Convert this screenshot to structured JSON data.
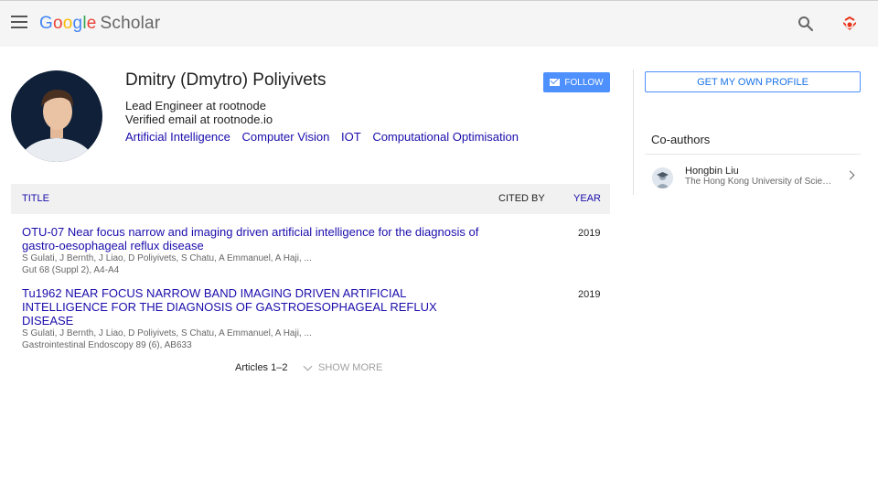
{
  "header": {
    "logo": {
      "g1": "G",
      "o1": "o",
      "o2": "o",
      "g2": "g",
      "l": "l",
      "e": "e",
      "scholar": "Scholar"
    },
    "icons": {
      "menu": "menu-icon",
      "search": "search-icon",
      "apps": "scholar-logo-icon"
    }
  },
  "profile": {
    "name": "Dmitry (Dmytro) Poliyivets",
    "affiliation": "Lead Engineer at rootnode",
    "verified": "Verified email at rootnode.io",
    "interests": [
      "Artificial Intelligence",
      "Computer Vision",
      "IOT",
      "Computational Optimisation"
    ],
    "follow_label": "FOLLOW"
  },
  "table": {
    "col_title": "TITLE",
    "col_cited": "CITED BY",
    "col_year": "YEAR",
    "articles": [
      {
        "title": "OTU-07 Near focus narrow and imaging driven artificial intelligence for the diagnosis of gastro-oesophageal reflux disease",
        "authors": "S Gulati, J Bernth, J Liao, D Poliyivets, S Chatu, A Emmanuel, A Haji, ...",
        "venue": "Gut 68 (Suppl 2), A4-A4",
        "year": "2019"
      },
      {
        "title": "Tu1962 NEAR FOCUS NARROW BAND IMAGING DRIVEN ARTIFICIAL INTELLIGENCE FOR THE DIAGNOSIS OF GASTROESOPHAGEAL REFLUX DISEASE",
        "authors": "S Gulati, J Bernth, J Liao, D Poliyivets, S Chatu, A Emmanuel, A Haji, ...",
        "venue": "Gastrointestinal Endoscopy 89 (6), AB633",
        "year": "2019"
      }
    ],
    "pager": "Articles 1–2",
    "show_more": "SHOW MORE"
  },
  "sidebar": {
    "own_profile_label": "GET MY OWN PROFILE",
    "coauthors_heading": "Co-authors",
    "coauthors": [
      {
        "name": "Hongbin Liu",
        "affiliation": "The Hong Kong University of Science and Technology"
      }
    ]
  },
  "colors": {
    "link": "#1a0dab",
    "accent": "#4d90fe",
    "topbar": "#f5f5f5"
  }
}
